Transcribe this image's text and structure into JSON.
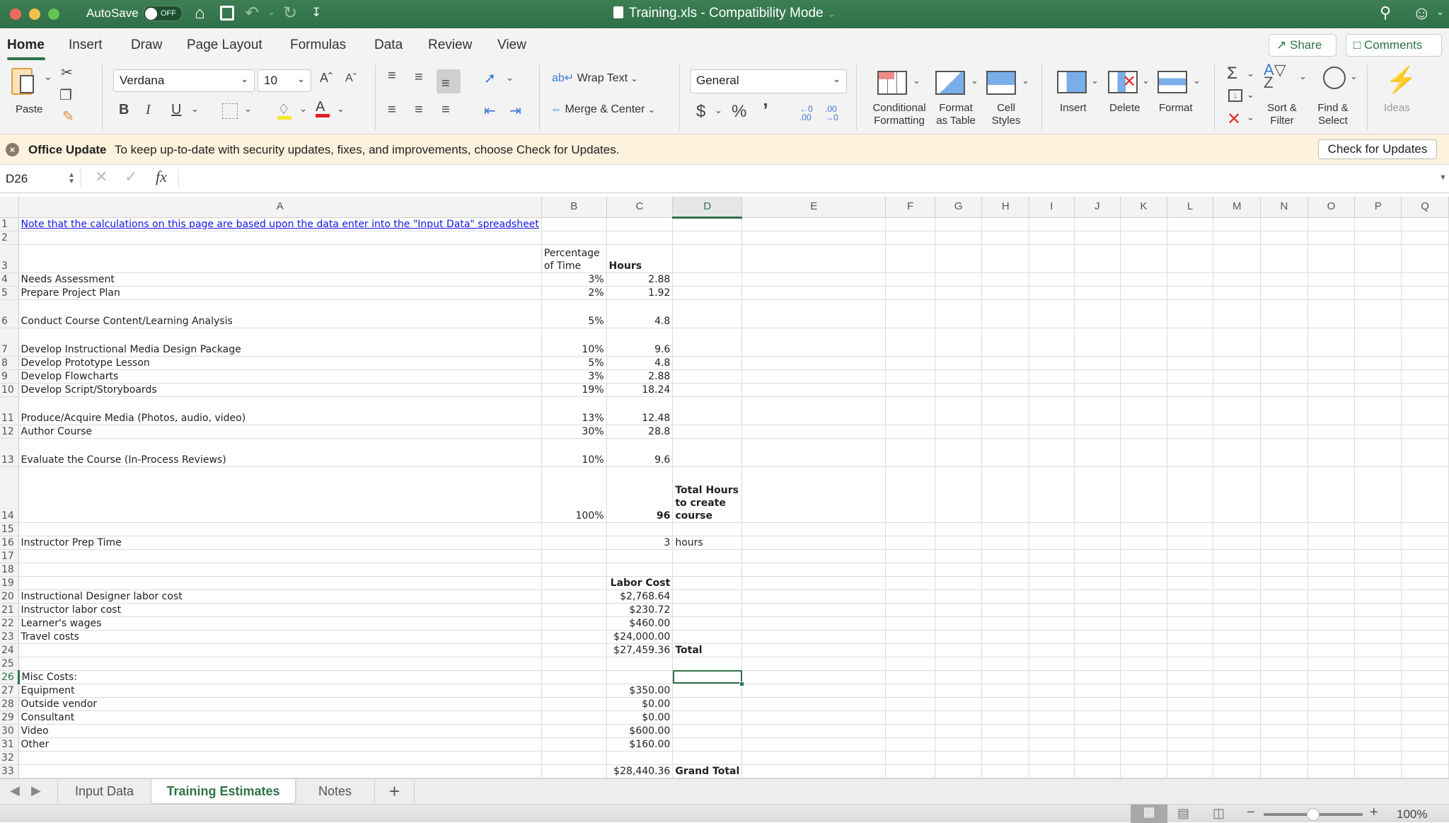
{
  "titlebar": {
    "autosave_label": "AutoSave",
    "autosave_state": "OFF",
    "title": "Training.xls  -  Compatibility Mode"
  },
  "ribbon_tabs": [
    "Home",
    "Insert",
    "Draw",
    "Page Layout",
    "Formulas",
    "Data",
    "Review",
    "View"
  ],
  "active_tab": "Home",
  "top_buttons": {
    "share": "Share",
    "comments": "Comments"
  },
  "ribbon": {
    "paste": "Paste",
    "font_name": "Verdana",
    "font_size": "10",
    "wrap_text": "Wrap Text",
    "merge_center": "Merge & Center",
    "number_format": "General",
    "conditional_formatting": [
      "Conditional",
      "Formatting"
    ],
    "format_as_table": [
      "Format",
      "as Table"
    ],
    "cell_styles": [
      "Cell",
      "Styles"
    ],
    "insert": "Insert",
    "delete": "Delete",
    "format": "Format",
    "sort_filter": [
      "Sort &",
      "Filter"
    ],
    "find_select": [
      "Find &",
      "Select"
    ],
    "ideas": "Ideas"
  },
  "update_bar": {
    "title": "Office Update",
    "message": "To keep up-to-date with security updates, fixes, and improvements, choose Check for Updates.",
    "button": "Check for Updates"
  },
  "formula_bar": {
    "name_box": "D26",
    "formula": ""
  },
  "columns": [
    "A",
    "B",
    "C",
    "D",
    "E",
    "F",
    "G",
    "H",
    "I",
    "J",
    "K",
    "L",
    "M",
    "N",
    "O",
    "P",
    "Q"
  ],
  "selected_cell": "D26",
  "rows": [
    {
      "n": "1",
      "a": "Note that the calculations on this page are based upon the data enter into the \"Input Data\" spreadsheet"
    },
    {
      "n": "2"
    },
    {
      "n": "3",
      "b": "Percentage of Time",
      "c": "Hours"
    },
    {
      "n": "4",
      "a": "Needs Assessment",
      "b": "3%",
      "c": "2.88"
    },
    {
      "n": "5",
      "a": "Prepare Project Plan",
      "b": "2%",
      "c": "1.92"
    },
    {
      "n": "6",
      "a": "Conduct Course Content/Learning Analysis",
      "b": "5%",
      "c": "4.8"
    },
    {
      "n": "7",
      "a": "Develop Instructional Media Design Package",
      "b": "10%",
      "c": "9.6"
    },
    {
      "n": "8",
      "a": "Develop Prototype Lesson",
      "b": "5%",
      "c": "4.8"
    },
    {
      "n": "9",
      "a": "Develop Flowcharts",
      "b": "3%",
      "c": "2.88"
    },
    {
      "n": "10",
      "a": "Develop Script/Storyboards",
      "b": "19%",
      "c": "18.24"
    },
    {
      "n": "11",
      "a": "Produce/Acquire Media (Photos, audio, video)",
      "b": "13%",
      "c": "12.48"
    },
    {
      "n": "12",
      "a": "Author Course",
      "b": "30%",
      "c": "28.8"
    },
    {
      "n": "13",
      "a": "Evaluate the Course (In-Process Reviews)",
      "b": "10%",
      "c": "9.6"
    },
    {
      "n": "14",
      "b": "100%",
      "c": "96",
      "d": "Total Hours to create course"
    },
    {
      "n": "15"
    },
    {
      "n": "16",
      "a": "Instructor Prep Time",
      "c": "3",
      "d": "hours"
    },
    {
      "n": "17"
    },
    {
      "n": "18"
    },
    {
      "n": "19",
      "c": "Labor Cost"
    },
    {
      "n": "20",
      "a": "Instructional Designer labor cost",
      "c": "$2,768.64"
    },
    {
      "n": "21",
      "a": "Instructor labor cost",
      "c": "$230.72"
    },
    {
      "n": "22",
      "a": "Learner's wages",
      "c": "$460.00"
    },
    {
      "n": "23",
      "a": "Travel costs",
      "c": "$24,000.00"
    },
    {
      "n": "24",
      "c": "$27,459.36",
      "d": "Total"
    },
    {
      "n": "25"
    },
    {
      "n": "26",
      "a": "Misc Costs:"
    },
    {
      "n": "27",
      "a": "Equipment",
      "c": "$350.00"
    },
    {
      "n": "28",
      "a": "Outside vendor",
      "c": "$0.00"
    },
    {
      "n": "29",
      "a": "Consultant",
      "c": "$0.00"
    },
    {
      "n": "30",
      "a": "Video",
      "c": "$600.00"
    },
    {
      "n": "31",
      "a": "Other",
      "c": "$160.00"
    },
    {
      "n": "32"
    },
    {
      "n": "33",
      "c": "$28,440.36",
      "d": "Grand Total"
    }
  ],
  "sheet_tabs": [
    "Input Data",
    "Training Estimates",
    "Notes"
  ],
  "active_sheet": "Training Estimates",
  "status": {
    "zoom": "100%",
    "zoom_fraction": 0.5
  }
}
